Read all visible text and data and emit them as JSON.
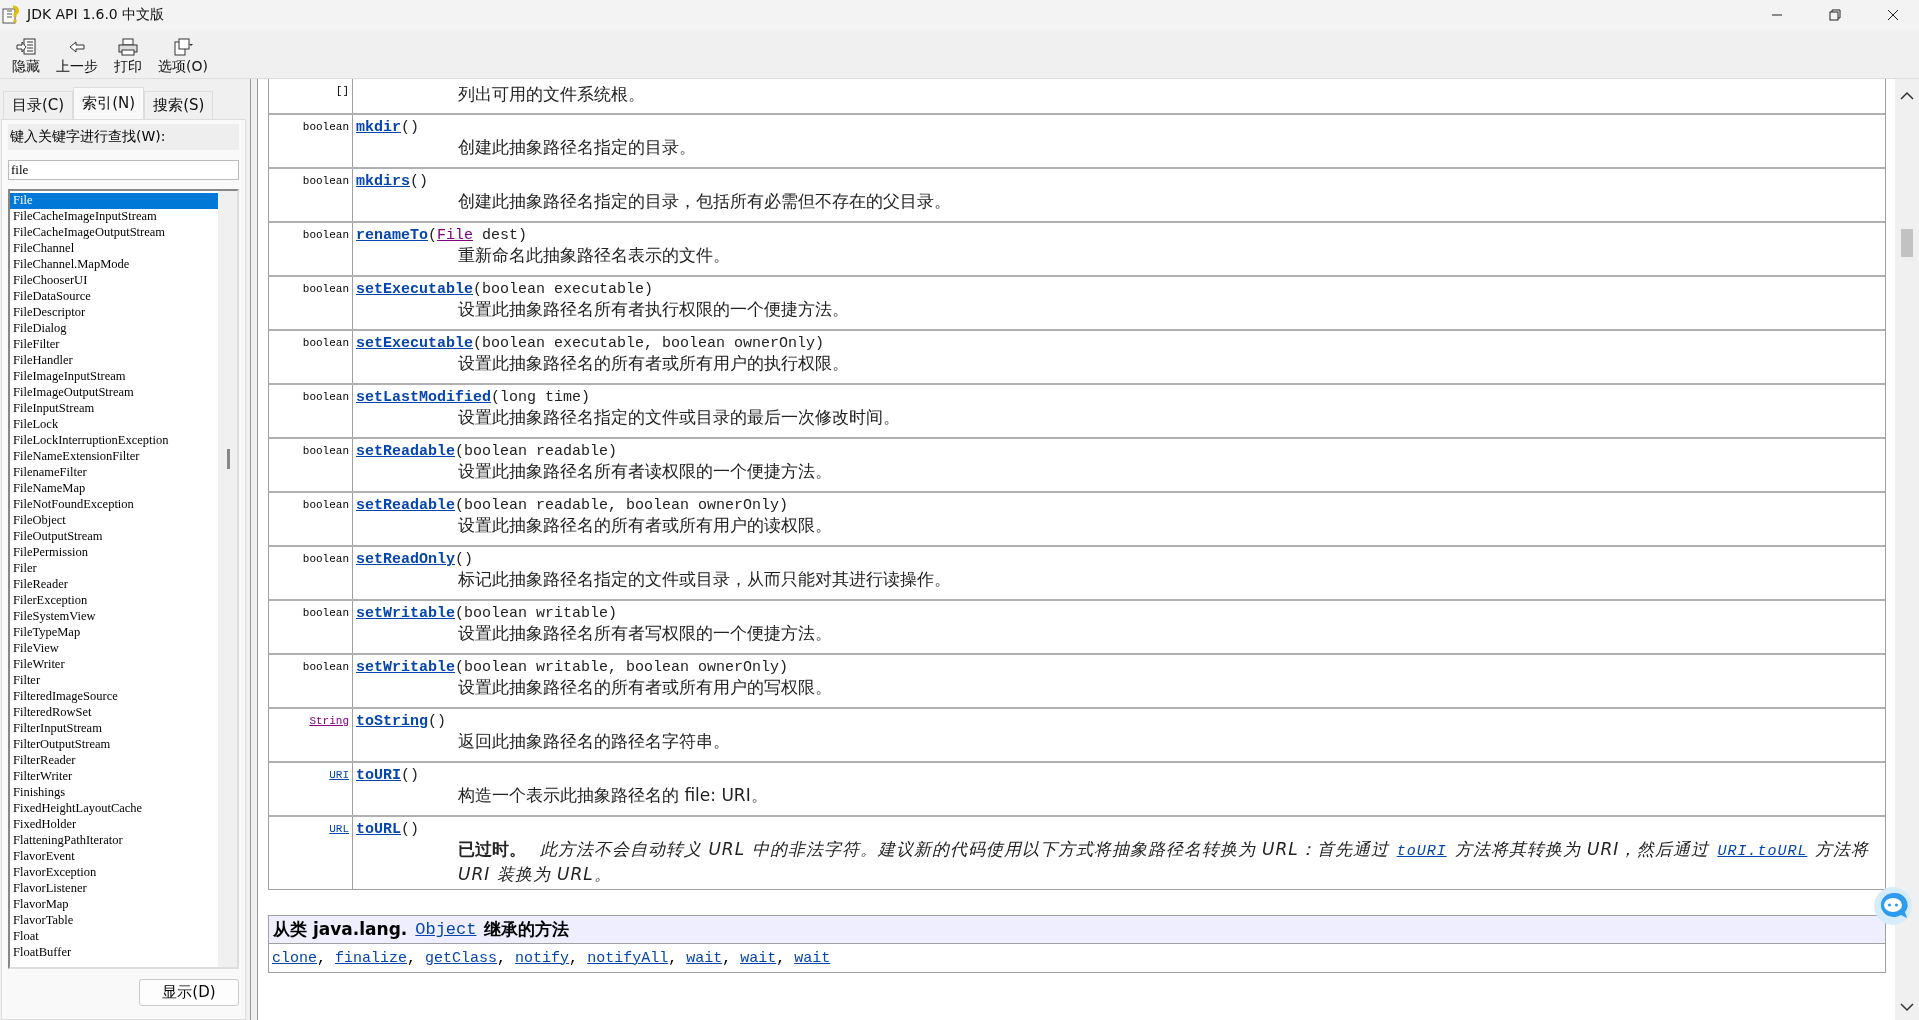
{
  "window": {
    "title": "JDK API 1.6.0 中文版"
  },
  "toolbar": [
    {
      "label": "隐藏",
      "kind": "hide"
    },
    {
      "label": "上一步",
      "kind": "back"
    },
    {
      "label": "打印",
      "kind": "print"
    },
    {
      "label": "选项(O)",
      "kind": "options"
    }
  ],
  "tabs": [
    {
      "label": "目录(C)",
      "selected": false
    },
    {
      "label": "索引(N)",
      "selected": true
    },
    {
      "label": "搜索(S)",
      "selected": false
    }
  ],
  "index": {
    "label": "键入关键字进行查找(W):",
    "value": "file",
    "button": "显示(D)",
    "items": [
      {
        "label": "File",
        "selected": true
      },
      {
        "label": "FileCacheImageInputStream",
        "selected": false
      },
      {
        "label": "FileCacheImageOutputStream",
        "selected": false
      },
      {
        "label": "FileChannel",
        "selected": false
      },
      {
        "label": "FileChannel.MapMode",
        "selected": false
      },
      {
        "label": "FileChooserUI",
        "selected": false
      },
      {
        "label": "FileDataSource",
        "selected": false
      },
      {
        "label": "FileDescriptor",
        "selected": false
      },
      {
        "label": "FileDialog",
        "selected": false
      },
      {
        "label": "FileFilter",
        "selected": false
      },
      {
        "label": "FileHandler",
        "selected": false
      },
      {
        "label": "FileImageInputStream",
        "selected": false
      },
      {
        "label": "FileImageOutputStream",
        "selected": false
      },
      {
        "label": "FileInputStream",
        "selected": false
      },
      {
        "label": "FileLock",
        "selected": false
      },
      {
        "label": "FileLockInterruptionException",
        "selected": false
      },
      {
        "label": "FileNameExtensionFilter",
        "selected": false
      },
      {
        "label": "FilenameFilter",
        "selected": false
      },
      {
        "label": "FileNameMap",
        "selected": false
      },
      {
        "label": "FileNotFoundException",
        "selected": false
      },
      {
        "label": "FileObject",
        "selected": false
      },
      {
        "label": "FileOutputStream",
        "selected": false
      },
      {
        "label": "FilePermission",
        "selected": false
      },
      {
        "label": "Filer",
        "selected": false
      },
      {
        "label": "FileReader",
        "selected": false
      },
      {
        "label": "FilerException",
        "selected": false
      },
      {
        "label": "FileSystemView",
        "selected": false
      },
      {
        "label": "FileTypeMap",
        "selected": false
      },
      {
        "label": "FileView",
        "selected": false
      },
      {
        "label": "FileWriter",
        "selected": false
      },
      {
        "label": "Filter",
        "selected": false
      },
      {
        "label": "FilteredImageSource",
        "selected": false
      },
      {
        "label": "FilteredRowSet",
        "selected": false
      },
      {
        "label": "FilterInputStream",
        "selected": false
      },
      {
        "label": "FilterOutputStream",
        "selected": false
      },
      {
        "label": "FilterReader",
        "selected": false
      },
      {
        "label": "FilterWriter",
        "selected": false
      },
      {
        "label": "Finishings",
        "selected": false
      },
      {
        "label": "FixedHeightLayoutCache",
        "selected": false
      },
      {
        "label": "FixedHolder",
        "selected": false
      },
      {
        "label": "FlatteningPathIterator",
        "selected": false
      },
      {
        "label": "FlavorEvent",
        "selected": false
      },
      {
        "label": "FlavorException",
        "selected": false
      },
      {
        "label": "FlavorListener",
        "selected": false
      },
      {
        "label": "FlavorMap",
        "selected": false
      },
      {
        "label": "FlavorTable",
        "selected": false
      },
      {
        "label": "Float",
        "selected": false
      },
      {
        "label": "FloatBuffer",
        "selected": false
      }
    ]
  },
  "methods": [
    {
      "type": "[]",
      "description": [
        {
          "kind": "text",
          "text": "列出可用的文件系统根。"
        }
      ]
    },
    {
      "type": "boolean",
      "name": "mkdir",
      "signature": [
        {
          "kind": "text",
          "text": "()"
        }
      ],
      "description": [
        {
          "kind": "text",
          "text": "创建此抽象路径名指定的目录。"
        }
      ]
    },
    {
      "type": "boolean",
      "name": "mkdirs",
      "signature": [
        {
          "kind": "text",
          "text": "()"
        }
      ],
      "description": [
        {
          "kind": "text",
          "text": "创建此抽象路径名指定的目录，包括所有必需但不存在的父目录。"
        }
      ]
    },
    {
      "type": "boolean",
      "name": "renameTo",
      "signature": [
        {
          "kind": "text",
          "text": "("
        },
        {
          "kind": "visited-link",
          "text": "File"
        },
        {
          "kind": "text",
          "text": " dest)"
        }
      ],
      "description": [
        {
          "kind": "text",
          "text": "重新命名此抽象路径名表示的文件。"
        }
      ]
    },
    {
      "type": "boolean",
      "name": "setExecutable",
      "signature": [
        {
          "kind": "text",
          "text": "(boolean executable)"
        }
      ],
      "description": [
        {
          "kind": "text",
          "text": "设置此抽象路径名所有者执行权限的一个便捷方法。"
        }
      ]
    },
    {
      "type": "boolean",
      "name": "setExecutable",
      "signature": [
        {
          "kind": "text",
          "text": "(boolean executable, boolean ownerOnly)"
        }
      ],
      "description": [
        {
          "kind": "text",
          "text": "设置此抽象路径名的所有者或所有用户的执行权限。"
        }
      ]
    },
    {
      "type": "boolean",
      "name": "setLastModified",
      "signature": [
        {
          "kind": "text",
          "text": "(long time)"
        }
      ],
      "description": [
        {
          "kind": "text",
          "text": "设置此抽象路径名指定的文件或目录的最后一次修改时间。"
        }
      ]
    },
    {
      "type": "boolean",
      "name": "setReadable",
      "signature": [
        {
          "kind": "text",
          "text": "(boolean readable)"
        }
      ],
      "description": [
        {
          "kind": "text",
          "text": "设置此抽象路径名所有者读权限的一个便捷方法。"
        }
      ]
    },
    {
      "type": "boolean",
      "name": "setReadable",
      "signature": [
        {
          "kind": "text",
          "text": "(boolean readable, boolean ownerOnly)"
        }
      ],
      "description": [
        {
          "kind": "text",
          "text": "设置此抽象路径名的所有者或所有用户的读权限。"
        }
      ]
    },
    {
      "type": "boolean",
      "name": "setReadOnly",
      "signature": [
        {
          "kind": "text",
          "text": "()"
        }
      ],
      "description": [
        {
          "kind": "text",
          "text": "标记此抽象路径名指定的文件或目录，从而只能对其进行读操作。"
        }
      ]
    },
    {
      "type": "boolean",
      "name": "setWritable",
      "signature": [
        {
          "kind": "text",
          "text": "(boolean writable)"
        }
      ],
      "description": [
        {
          "kind": "text",
          "text": "设置此抽象路径名所有者写权限的一个便捷方法。"
        }
      ]
    },
    {
      "type": "boolean",
      "name": "setWritable",
      "signature": [
        {
          "kind": "text",
          "text": "(boolean writable, boolean ownerOnly)"
        }
      ],
      "description": [
        {
          "kind": "text",
          "text": "设置此抽象路径名的所有者或所有用户的写权限。"
        }
      ]
    },
    {
      "type": {
        "kind": "visited-link",
        "text": "String"
      },
      "name": "toString",
      "signature": [
        {
          "kind": "text",
          "text": "()"
        }
      ],
      "description": [
        {
          "kind": "text",
          "text": "返回此抽象路径名的路径名字符串。"
        }
      ]
    },
    {
      "type": {
        "kind": "link",
        "text": "URI"
      },
      "name": "toURI",
      "signature": [
        {
          "kind": "text",
          "text": "()"
        }
      ],
      "description": [
        {
          "kind": "text",
          "text": "构造一个表示此抽象路径名的 file: URI。"
        }
      ]
    },
    {
      "type": {
        "kind": "link",
        "text": "URL"
      },
      "name": "toURL",
      "signature": [
        {
          "kind": "text",
          "text": "()"
        }
      ],
      "description": [
        {
          "kind": "deprecated",
          "text": "已过时。"
        },
        {
          "kind": "italic",
          "text": "此方法不会自动转义 URL 中的非法字符。建议新的代码使用以下方式将抽象路径名转换为 URL：首先通过"
        },
        {
          "kind": "italic-link",
          "text": "toURI"
        },
        {
          "kind": "italic",
          "text": "方法将其转换为 URI，然后通过"
        },
        {
          "kind": "italic-link",
          "text": "URI.toURL"
        },
        {
          "kind": "italic",
          "text": "方法将 URI 装换为 URL。"
        }
      ]
    }
  ],
  "inherited": {
    "prefix": "从类 java.lang.",
    "class_link": "Object",
    "suffix": "继承的方法",
    "separator": ", ",
    "methods": [
      "clone",
      "finalize",
      "getClass",
      "notify",
      "notifyAll",
      "wait",
      "wait",
      "wait"
    ]
  }
}
